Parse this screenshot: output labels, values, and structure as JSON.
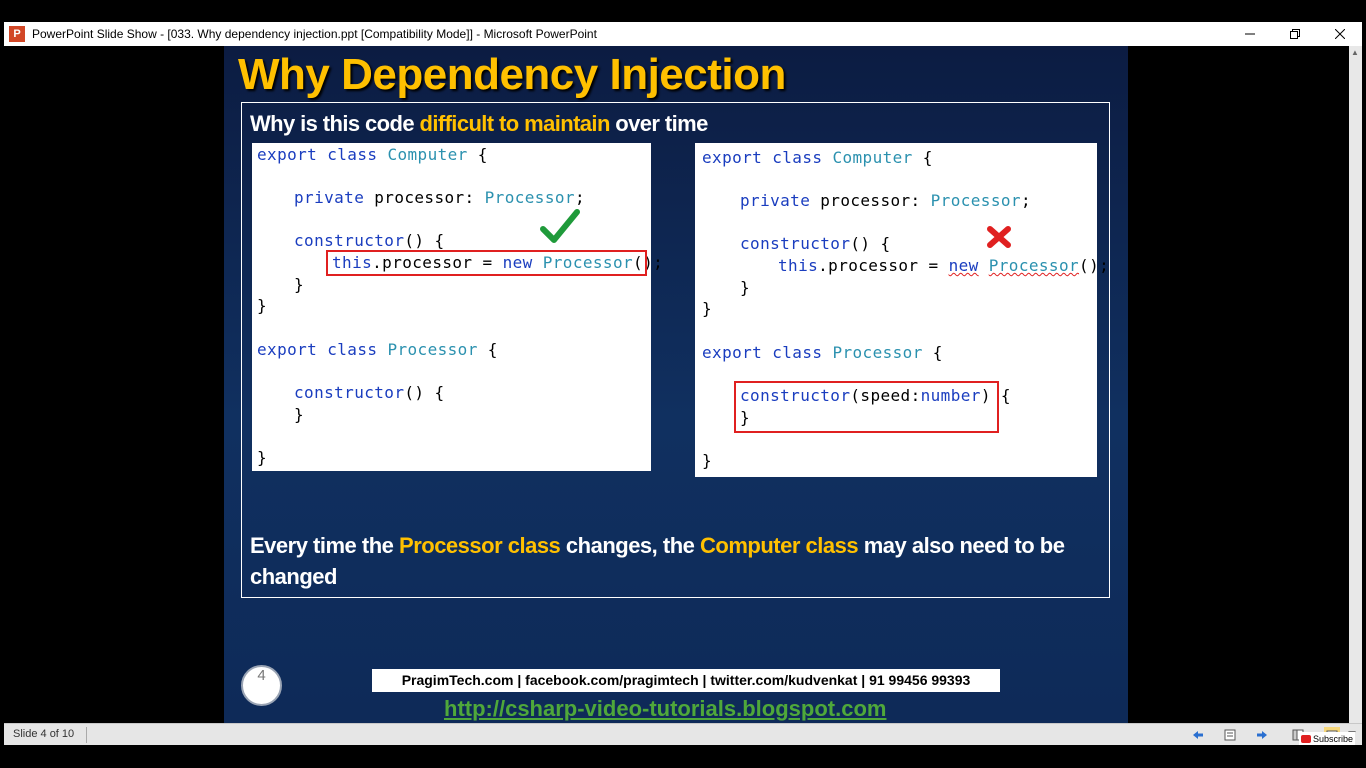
{
  "window": {
    "title": "PowerPoint Slide Show - [033. Why dependency injection.ppt [Compatibility Mode]] - Microsoft PowerPoint",
    "app_icon_letter": "P",
    "app_icon_color": "#d24726"
  },
  "slide": {
    "title": "Why Dependency Injection",
    "question": {
      "before": "Why is this code ",
      "highlight": "difficult to maintain",
      "after": " over time"
    },
    "left_code": [
      "export class Computer {",
      "",
      "    private processor: Processor;",
      "",
      "    constructor() {",
      "        this.processor = new Processor();",
      "    }",
      "}",
      "",
      "export class Processor {",
      "",
      "    constructor() {",
      "    }",
      "",
      "}"
    ],
    "right_code": [
      "export class Computer {",
      "",
      "    private processor: Processor;",
      "",
      "    constructor() {",
      "        this.processor = new Processor();",
      "    }",
      "}",
      "",
      "export class Processor {",
      "",
      "    constructor(speed:number) {",
      "    }",
      "",
      "}"
    ],
    "left_mark": "✔",
    "right_mark": "✖",
    "statement": {
      "p1": "Every time the ",
      "h1": "Processor class",
      "p2": " changes, the ",
      "h2": "Computer class",
      "p3": " may also need to be changed"
    },
    "slide_number": "4",
    "footer_text": "PragimTech.com | facebook.com/pragimtech | twitter.com/kudvenkat | 91 99456 99393",
    "footer_url": "http://csharp-video-tutorials.blogspot.com",
    "accent_color": "#ffc000",
    "url_color": "#4fa83a"
  },
  "statusbar": {
    "slide_indicator": "Slide 4 of 10",
    "subscribe_label": "Subscribe"
  }
}
